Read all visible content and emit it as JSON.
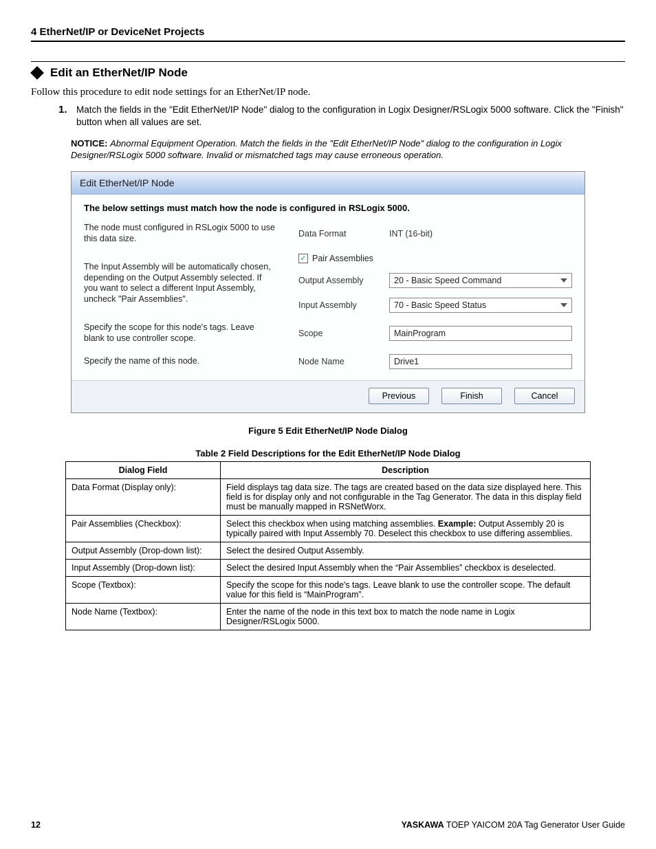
{
  "header": {
    "section": "4 EtherNet/IP or DeviceNet Projects"
  },
  "subheader": "Edit an EtherNet/IP Node",
  "intro": "Follow this procedure to edit node settings for an EtherNet/IP node.",
  "step": {
    "num": "1.",
    "text": "Match the fields in the \"Edit EtherNet/IP Node\" dialog to the configuration in Logix Designer/RSLogix 5000 software. Click the \"Finish\" button when all values are set."
  },
  "notice": {
    "label": "NOTICE:",
    "body": "Abnormal Equipment Operation. Match the fields in the \"Edit EtherNet/IP Node\" dialog to the configuration in Logix Designer/RSLogix 5000 software. Invalid or mismatched tags may cause erroneous operation."
  },
  "dialog": {
    "title": "Edit EtherNet/IP Node",
    "intro": "The below settings must match how the node is configured in RSLogix 5000.",
    "rows": {
      "data_format": {
        "desc": "The node must configured in RSLogix 5000 to use this data size.",
        "label": "Data Format",
        "value": "INT (16-bit)"
      },
      "pair": {
        "desc": "The Input Assembly will be automatically chosen, depending on the Output Assembly selected.  If you want to select a different Input Assembly, uncheck \"Pair Assemblies\".",
        "check_label": "Pair Assemblies",
        "out_label": "Output Assembly",
        "out_value": "20 - Basic Speed Command",
        "in_label": "Input Assembly",
        "in_value": "70 - Basic Speed Status"
      },
      "scope": {
        "desc": "Specify the scope for this node's tags. Leave blank to use controller scope.",
        "label": "Scope",
        "value": "MainProgram"
      },
      "node": {
        "desc": "Specify the name of this node.",
        "label": "Node Name",
        "value": "Drive1"
      }
    },
    "buttons": {
      "prev": "Previous",
      "finish": "Finish",
      "cancel": "Cancel"
    }
  },
  "figure_caption": "Figure 5  Edit EtherNet/IP Node Dialog",
  "table_caption": "Table 2  Field Descriptions for the Edit EtherNet/IP Node Dialog",
  "table": {
    "headers": {
      "field": "Dialog Field",
      "desc": "Description"
    },
    "rows": [
      {
        "field": "Data Format (Display only):",
        "desc": "Field displays tag data size. The tags are created based on the data size displayed here. This field is for display only and not configurable in the Tag Generator. The data in this display field must be manually mapped in RSNetWorx."
      },
      {
        "field": "Pair Assemblies (Checkbox):",
        "desc_pre": "Select this checkbox when using matching assemblies. ",
        "desc_bold": "Example:",
        "desc_post": " Output Assembly 20 is typically paired with Input Assembly 70. Deselect this checkbox to use differing assemblies."
      },
      {
        "field": "Output Assembly (Drop-down list):",
        "desc": "Select the desired Output Assembly."
      },
      {
        "field": "Input Assembly (Drop-down list):",
        "desc": "Select the desired Input Assembly when the “Pair Assemblies” checkbox is deselected."
      },
      {
        "field": "Scope (Textbox):",
        "desc": "Specify the scope for this node's tags. Leave blank to use the controller scope. The default value for this field is “MainProgram”."
      },
      {
        "field": "Node Name (Textbox):",
        "desc": "Enter the name of the node in this text box to match the node name in Logix Designer/RSLogix 5000."
      }
    ]
  },
  "footer": {
    "page": "12",
    "brand": "YASKAWA",
    "doc": " TOEP YAICOM 20A Tag Generator User Guide"
  }
}
